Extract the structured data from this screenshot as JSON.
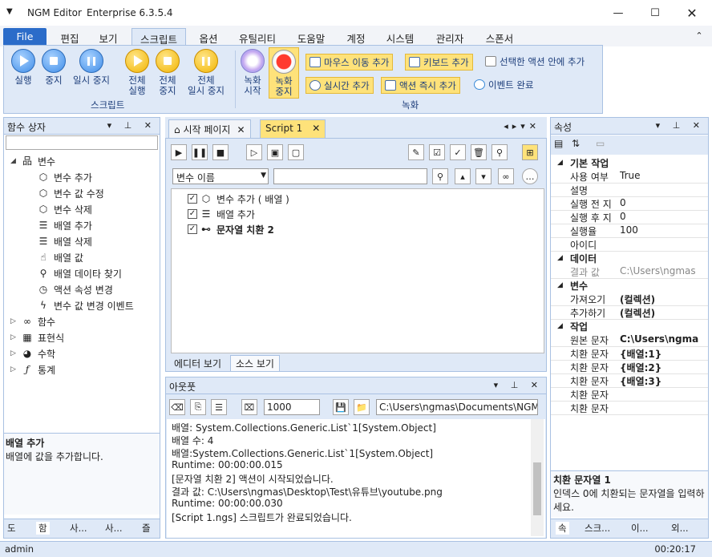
{
  "window": {
    "title": "NGM Editor",
    "edition": "Enterprise 6.3.5.4"
  },
  "ribbon_tabs": [
    "File",
    "편집",
    "보기",
    "스크립트",
    "옵션",
    "유틸리티",
    "도움말",
    "계정",
    "시스템",
    "관리자",
    "스폰서"
  ],
  "ribbon": {
    "script_group": {
      "label": "스크립트",
      "run": "실행",
      "stop": "중지",
      "pause": "일시 중지",
      "run_all_1": "전체",
      "run_all_2": "실행",
      "stop_all_1": "전체",
      "stop_all_2": "중지",
      "pause_all_1": "전체",
      "pause_all_2": "일시 중지"
    },
    "record_group": {
      "label": "녹화",
      "record_start_1": "녹화",
      "record_start_2": "시작",
      "record_stop_1": "녹화",
      "record_stop_2": "중지",
      "mouse_move": "마우스 이동 추가",
      "keyboard": "키보드 추가",
      "in_selected": "선택한 액션 안에 추가",
      "realtime": "실시간 추가",
      "instant": "액션 즉시 추가",
      "event_done": "이벤트 완료"
    }
  },
  "left_panel": {
    "title": "함수 상자",
    "tree": [
      {
        "label": "변수",
        "icon": "variable-group-icon"
      },
      {
        "label": "변수 추가",
        "icon": "cube-icon"
      },
      {
        "label": "변수 값 수정",
        "icon": "cube-icon"
      },
      {
        "label": "변수 삭제",
        "icon": "cube-icon"
      },
      {
        "label": "배열 추가",
        "icon": "database-icon"
      },
      {
        "label": "배열 삭제",
        "icon": "database-icon"
      },
      {
        "label": "배열 값",
        "icon": "pointer-icon"
      },
      {
        "label": "배열 데이타 찾기",
        "icon": "search-icon"
      },
      {
        "label": "액션 속성 변경",
        "icon": "clock-icon"
      },
      {
        "label": "변수 값 변경 이벤트",
        "icon": "lightning-icon"
      },
      {
        "label": "함수",
        "icon": "infinity-icon"
      },
      {
        "label": "표현식",
        "icon": "grid-icon"
      },
      {
        "label": "수학",
        "icon": "pie-icon"
      },
      {
        "label": "통계",
        "icon": "fx-icon"
      }
    ],
    "desc_title": "배열 추가",
    "desc_text": "배열에 값을 추가합니다.",
    "bottom_tabs": [
      "도",
      "함",
      "사...",
      "사...",
      "즐"
    ]
  },
  "doc_tabs": [
    "시작 페이지",
    "Script 1"
  ],
  "editor": {
    "search_placeholder": "변수 이름",
    "rows": [
      {
        "label": "변수 추가 ( 배열 )",
        "checked": true
      },
      {
        "label": "배열 추가",
        "checked": true
      },
      {
        "label": "문자열 치환 2",
        "checked": true
      }
    ],
    "view_tabs": [
      "에디터 보기",
      "소스 보기"
    ]
  },
  "output": {
    "title": "아웃풋",
    "count": "1000",
    "path": "C:\\Users\\ngmas\\Documents\\NGM6\\",
    "lines": [
      "배열: System.Collections.Generic.List`1[System.Object]",
      "배열 수: 4",
      "배열:System.Collections.Generic.List`1[System.Object]",
      "Runtime: 00:00:00.015",
      "[문자열 치환 2] 액션이 시작되었습니다.",
      "결과 값: C:\\Users\\ngmas\\Desktop\\Test\\유튜브\\youtube.png",
      "Runtime: 00:00:00.030",
      "[Script 1.ngs] 스크립트가 완료되었습니다."
    ]
  },
  "properties": {
    "title": "속성",
    "categories": {
      "basic": "기본 작업",
      "data": "데이터",
      "variable": "변수",
      "task": "작업"
    },
    "basic": [
      [
        "사용 여부",
        "True"
      ],
      [
        "설명",
        ""
      ],
      [
        "실행 전 지",
        "0"
      ],
      [
        "실행 후 지",
        "0"
      ],
      [
        "실행율",
        "100"
      ],
      [
        "아이디",
        ""
      ]
    ],
    "data": [
      [
        "결과 값",
        "C:\\Users\\ngmas"
      ]
    ],
    "variable": [
      [
        "가져오기",
        "(컬렉션)"
      ],
      [
        "추가하기",
        "(컬렉션)"
      ]
    ],
    "task": [
      [
        "원본 문자",
        "C:\\Users\\ngma"
      ],
      [
        "치환 문자",
        "{배열:1}"
      ],
      [
        "치환 문자",
        "{배열:2}"
      ],
      [
        "치환 문자",
        "{배열:3}"
      ],
      [
        "치환 문자",
        ""
      ],
      [
        "치환 문자",
        ""
      ]
    ],
    "desc_title": "치환 문자열 1",
    "desc_text": "인덱스 0에 치환되는 문자열을 입력하세요.",
    "bottom_tabs": [
      "속",
      "스크...",
      "이...",
      "외..."
    ]
  },
  "status": {
    "user": "admin",
    "time": "00:20:17"
  }
}
